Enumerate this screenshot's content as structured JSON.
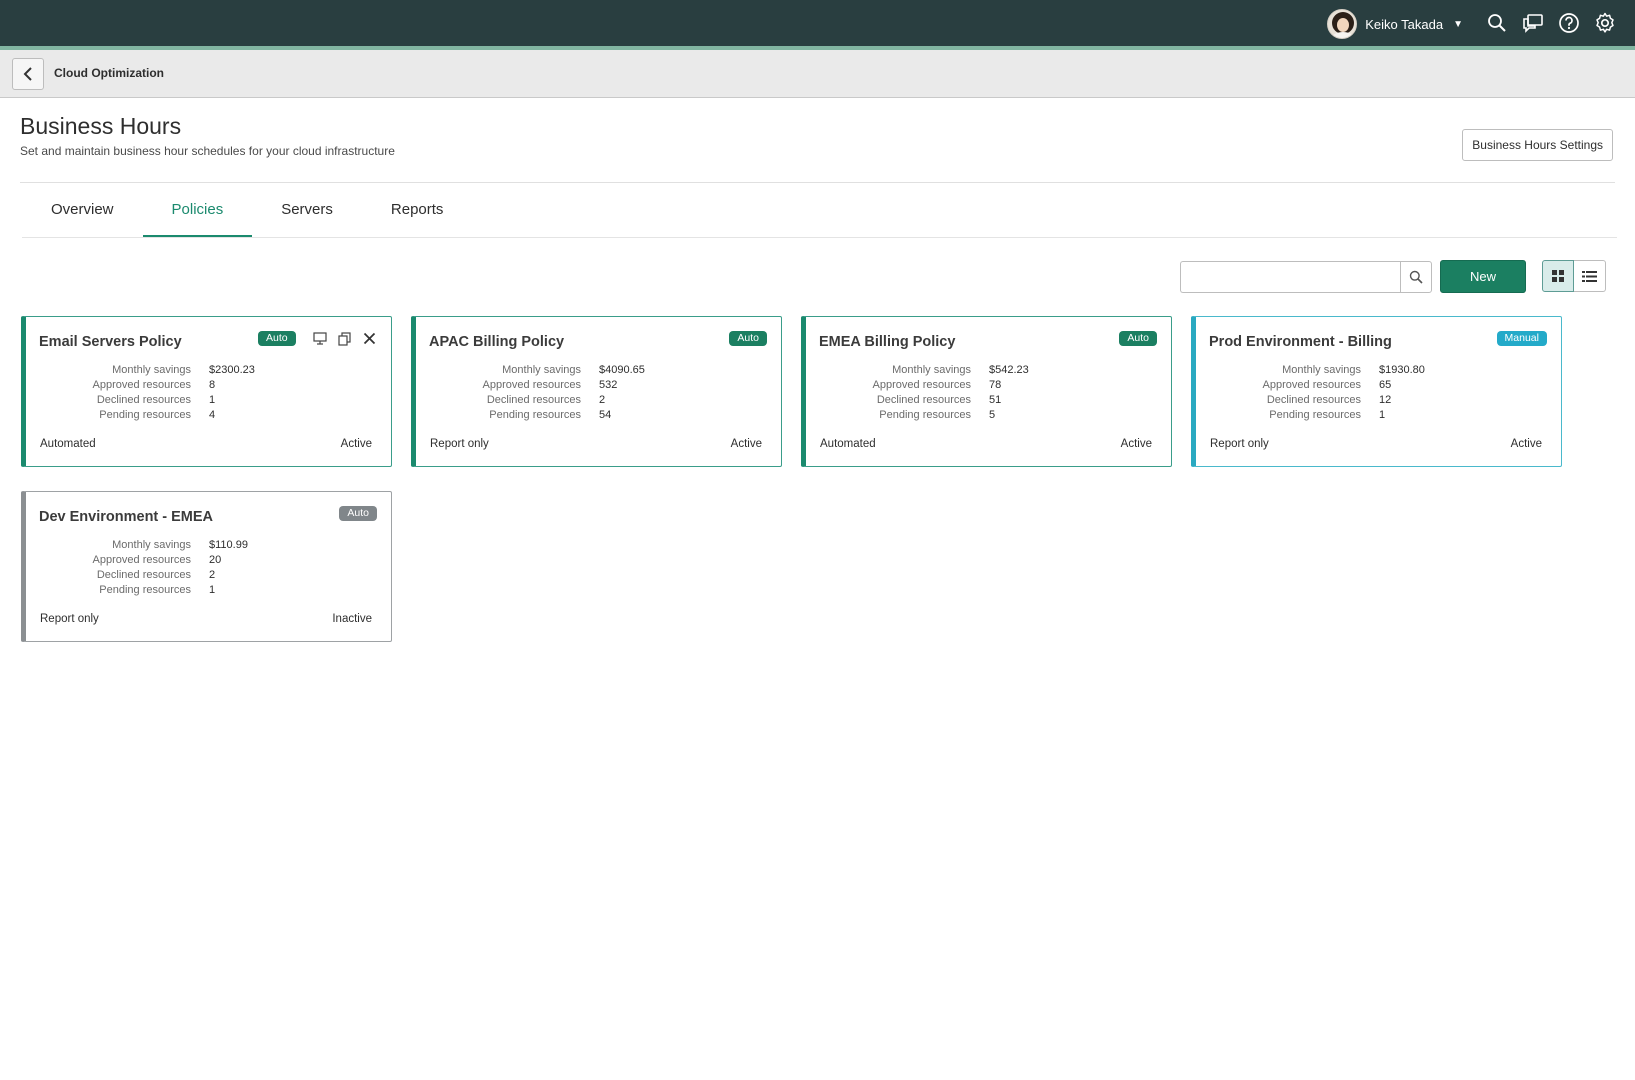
{
  "header": {
    "user_name": "Keiko Takada",
    "icons": [
      "search-icon",
      "chat-icon",
      "help-icon",
      "gear-icon"
    ]
  },
  "breadcrumb": {
    "title": "Cloud Optimization"
  },
  "page": {
    "title": "Business Hours",
    "subtitle": "Set and maintain business hour schedules for your cloud infrastructure",
    "settings_button": "Business Hours Settings"
  },
  "tabs": [
    {
      "label": "Overview",
      "active": false
    },
    {
      "label": "Policies",
      "active": true
    },
    {
      "label": "Servers",
      "active": false
    },
    {
      "label": "Reports",
      "active": false
    }
  ],
  "toolbar": {
    "search_placeholder": "",
    "new_label": "New",
    "view_mode": "grid"
  },
  "labels": {
    "monthly_savings": "Monthly savings",
    "approved": "Approved resources",
    "declined": "Declined resources",
    "pending": "Pending resources"
  },
  "colors": {
    "topbar": "#293e40",
    "accent_green": "#1b7f61",
    "manual_blue": "#23aac9",
    "inactive_gray": "#80868a"
  },
  "policies": [
    {
      "title": "Email Servers Policy",
      "badge": "Auto",
      "monthly_savings": "$2300.23",
      "approved": "8",
      "declined": "1",
      "pending": "4",
      "mode": "Automated",
      "status": "Active"
    },
    {
      "title": "APAC Billing Policy",
      "badge": "Auto",
      "monthly_savings": "$4090.65",
      "approved": "532",
      "declined": "2",
      "pending": "54",
      "mode": "Report only",
      "status": "Active"
    },
    {
      "title": "EMEA Billing Policy",
      "badge": "Auto",
      "monthly_savings": "$542.23",
      "approved": "78",
      "declined": "51",
      "pending": "5",
      "mode": "Automated",
      "status": "Active"
    },
    {
      "title": "Prod Environment - Billing",
      "badge": "Manual",
      "monthly_savings": "$1930.80",
      "approved": "65",
      "declined": "12",
      "pending": "1",
      "mode": "Report only",
      "status": "Active"
    },
    {
      "title": "Dev Environment - EMEA",
      "badge": "Auto",
      "monthly_savings": "$110.99",
      "approved": "20",
      "declined": "2",
      "pending": "1",
      "mode": "Report only",
      "status": "Inactive"
    }
  ]
}
